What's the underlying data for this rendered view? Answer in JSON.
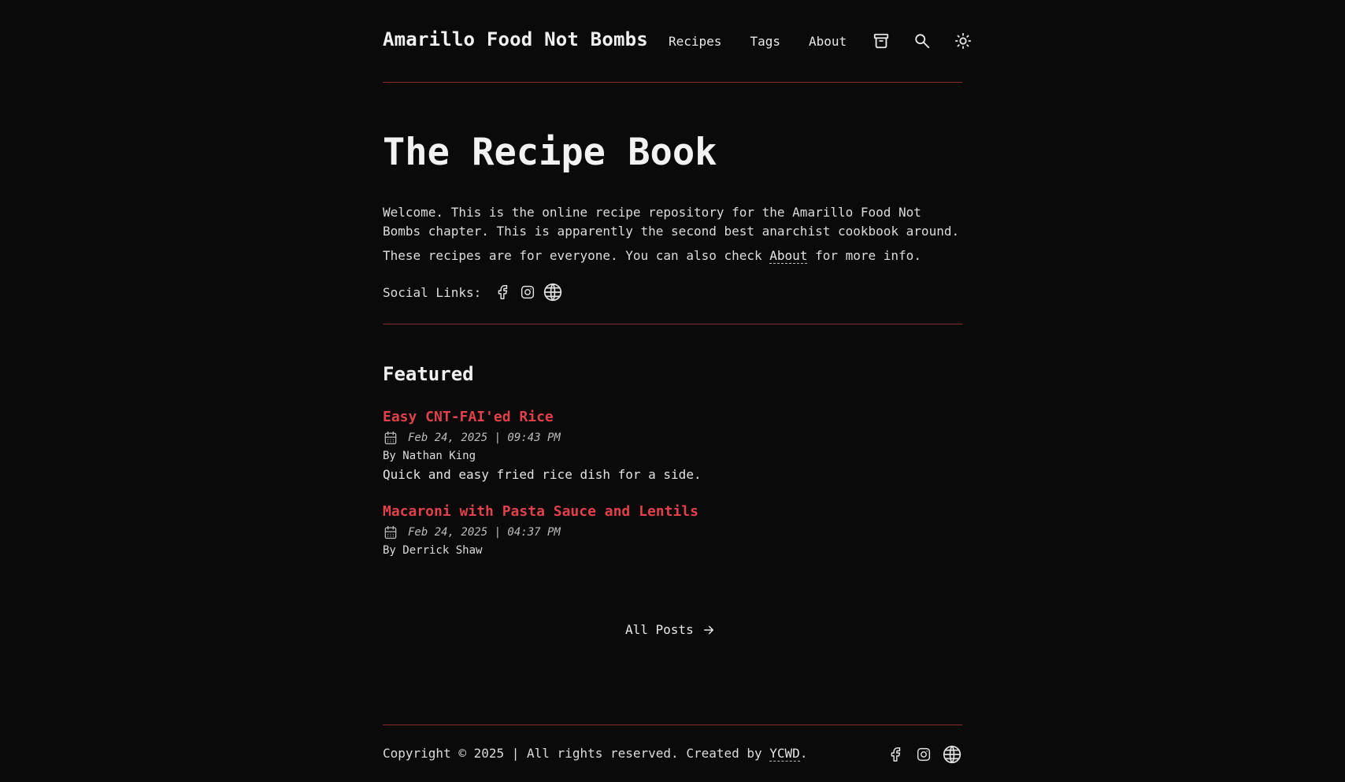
{
  "header": {
    "site_title": "Amarillo Food Not Bombs",
    "nav": {
      "recipes": "Recipes",
      "tags": "Tags",
      "about": "About"
    },
    "icons": [
      "archive-icon",
      "search-icon",
      "sun-icon"
    ]
  },
  "hero": {
    "title": "The Recipe Book",
    "intro": "Welcome. This is the online recipe repository for the Amarillo Food Not Bombs chapter. This is apparently the second best anarchist cookbook around.",
    "intro2_before": "These recipes are for everyone. You can also check ",
    "intro2_link": "About",
    "intro2_after": " for more info.",
    "social_label": "Social Links:",
    "social_icons": [
      "facebook-icon",
      "instagram-icon",
      "globe-icon"
    ]
  },
  "featured": {
    "title": "Featured",
    "posts": [
      {
        "title": "Easy CNT-FAI'ed Rice",
        "date": "Feb 24, 2025 | 09:43 PM",
        "author": "By Nathan King",
        "description": "Quick and easy fried rice dish for a side."
      },
      {
        "title": "Macaroni with Pasta Sauce and Lentils",
        "date": "Feb 24, 2025 | 04:37 PM",
        "author": "By Derrick Shaw"
      }
    ]
  },
  "all_posts": "All Posts",
  "footer": {
    "copyright_before": "Copyright © 2025 | All rights reserved. Created by ",
    "copyright_link": "YCWD",
    "copyright_after": ".",
    "social_icons": [
      "facebook-icon",
      "instagram-icon",
      "globe-icon"
    ]
  },
  "colors": {
    "background": "#0a0a0b",
    "accent": "#e0414a",
    "divider": "#8a2b30",
    "text": "#e6e6e6"
  }
}
